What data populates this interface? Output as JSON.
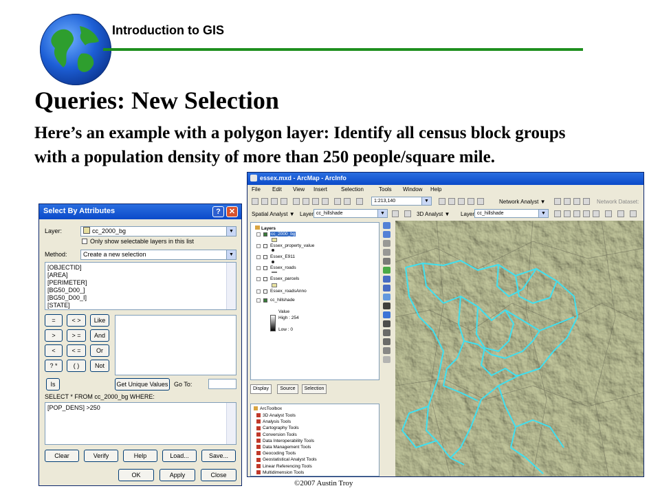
{
  "header": {
    "title": "Introduction to GIS"
  },
  "slide": {
    "title": "Queries: New Selection",
    "body": "Here’s an example with a polygon layer: Identify all census block groups with a population density of more than 250 people/square mile.",
    "copyright": "©2007 Austin Troy"
  },
  "dialog": {
    "title": "Select By Attributes",
    "help_label": "?",
    "close_label": "✕",
    "layer_label": "Layer:",
    "layer_value": "cc_2000_bg",
    "only_selectable_label": "Only show selectable layers in this list",
    "method_label": "Method:",
    "method_value": "Create a new selection",
    "fields": [
      "[OBJECTID]",
      "[AREA]",
      "[PERIMETER]",
      "[BG50_D00_]",
      "[BG50_D00_I]",
      "[STATE]"
    ],
    "operators": [
      [
        "=",
        "< >",
        "Like"
      ],
      [
        ">",
        "> =",
        "And"
      ],
      [
        "<",
        "< =",
        "Or"
      ],
      [
        "? *",
        "( )",
        "Not"
      ]
    ],
    "is_label": "Is",
    "get_unique_label": "Get Unique Values",
    "goto_label": "Go To:",
    "sql_prefix": "SELECT * FROM cc_2000_bg WHERE:",
    "expression": "[POP_DENS] >250",
    "buttons_row1": [
      "Clear",
      "Verify",
      "Help",
      "Load...",
      "Save..."
    ],
    "buttons_row2": [
      "OK",
      "Apply",
      "Close"
    ]
  },
  "arcmap": {
    "title": "essex.mxd - ArcMap - ArcInfo",
    "menus": [
      "File",
      "Edit",
      "View",
      "Insert",
      "Selection",
      "Tools",
      "Window",
      "Help"
    ],
    "scale": "1:213,140",
    "network_analyst": "Network Analyst ▼",
    "network_dataset": "Network Dataset:",
    "spatial_analyst": "Spatial Analyst ▼",
    "layer_label_1": "Layer:",
    "layer_value_1": "cc_hillshade",
    "analyst_3d": "3D Analyst ▼",
    "layer_label_2": "Layer:",
    "layer_value_2": "cc_hillshade",
    "toc": {
      "root": "Layers",
      "layers": [
        {
          "name": "cc_2000_bg",
          "checked": true,
          "selected": true
        },
        {
          "name": "Essex_property_value",
          "checked": false
        },
        {
          "name": "Essex_E911",
          "checked": false
        },
        {
          "name": "Essex_roads",
          "checked": false
        },
        {
          "name": "Essex_parcels",
          "checked": false
        },
        {
          "name": "Essex_roadsAnno",
          "checked": false
        },
        {
          "name": "cc_hillshade",
          "checked": true
        }
      ],
      "value_label": "Value",
      "high_label": "High : 254",
      "low_label": "Low : 0"
    },
    "tabs": [
      "Display",
      "Source",
      "Selection"
    ],
    "toolbox": {
      "root": "ArcToolbox",
      "items": [
        "3D Analyst Tools",
        "Analysis Tools",
        "Cartography Tools",
        "Conversion Tools",
        "Data Interoperability Tools",
        "Data Management Tools",
        "Geocoding Tools",
        "Geostatistical Analyst Tools",
        "Linear Referencing Tools",
        "Multidimension Tools"
      ]
    }
  },
  "colors": {
    "rule": "#1f8f1f",
    "selection_outline": "#3fe0f0",
    "titlebar": "#0b4ac9"
  }
}
